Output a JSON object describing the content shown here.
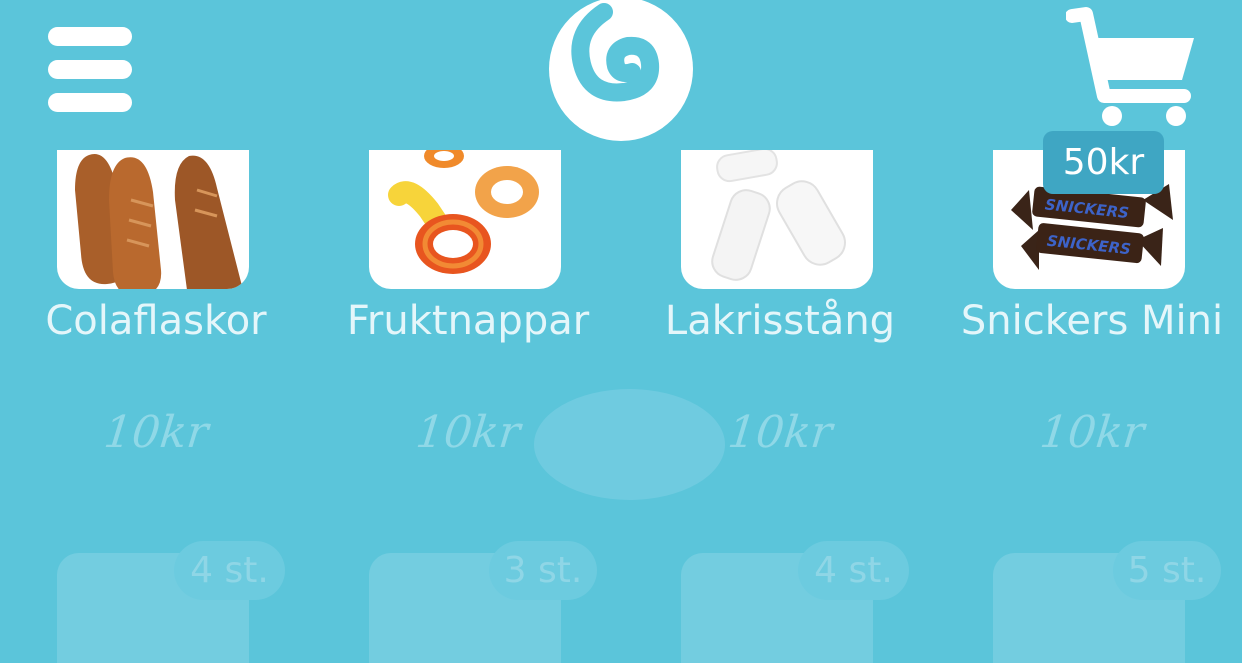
{
  "header": {
    "menu_icon": "hamburger-menu-icon",
    "logo_icon": "swirl-logo-icon",
    "cart_icon": "shopping-cart-icon",
    "cart_total": "50kr"
  },
  "colors": {
    "background": "#5bc5da",
    "cart_badge": "#3fa6c3",
    "card": "#ffffff"
  },
  "products": [
    {
      "name": "Colaflaskor",
      "price": "10kr",
      "next_stock": "4 st."
    },
    {
      "name": "Fruktnappar",
      "price": "10kr",
      "next_stock": "3 st."
    },
    {
      "name": "Lakrisstång",
      "price": "10kr",
      "next_stock": "4 st."
    },
    {
      "name": "Snickers Mini",
      "price": "10kr",
      "next_stock": "5 st."
    }
  ]
}
